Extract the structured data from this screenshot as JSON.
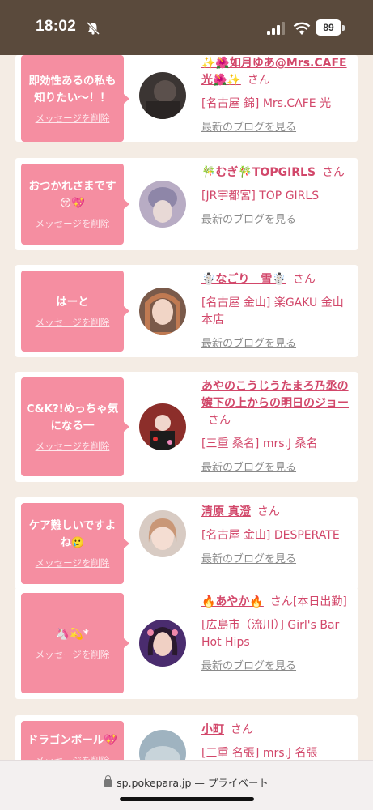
{
  "status_bar": {
    "time": "18:02",
    "battery": "89"
  },
  "messages": [
    {
      "message": "即効性あるの私も知りたい〜！！",
      "delete_label": "メッセージを削除",
      "cast_name": "✨🌺如月ゆあ@Mrs.CAFE光🌺✨",
      "honorific": "さん",
      "shop": "[名古屋 錦] Mrs.CAFE 光",
      "blog_link": "最新のブログを見る",
      "avatar_color": "#3b3533"
    },
    {
      "message": "おつかれさまです😚💖",
      "delete_label": "メッセージを削除",
      "cast_name": "🎋むぎ🎋TOPGIRLS",
      "honorific": "さん",
      "shop": "[JR宇都宮] TOP GIRLS",
      "blog_link": "最新のブログを見る",
      "avatar_color": "#a99cb6"
    },
    {
      "message": "はーと",
      "delete_label": "メッセージを削除",
      "cast_name": "☃️なごり　雪☃️",
      "honorific": "さん",
      "shop": "[名古屋 金山] 楽GAKU 金山本店",
      "blog_link": "最新のブログを見る",
      "avatar_color": "#7a5a4a"
    },
    {
      "message": "C&K?!めっちゃ気になる一",
      "delete_label": "メッセージを削除",
      "cast_name": "あやのこうじうたまろ乃丞の嬢下の上からの明日のジョー",
      "honorific": "さん",
      "shop": "[三重 桑名] mrs.J 桑名",
      "blog_link": "最新のブログを見る",
      "avatar_color": "#8c2e2a"
    },
    {
      "message": "ケア難しいですよね🥲",
      "delete_label": "メッセージを削除",
      "cast_name": "清原 真澄",
      "honorific": "さん",
      "shop": "[名古屋 金山] DESPERATE",
      "blog_link": "最新のブログを見る",
      "avatar_color": "#c9b8b0"
    },
    {
      "message": "🦄💫*",
      "delete_label": "メッセージを削除",
      "cast_name": "🔥あやか🔥",
      "honorific": "さん[本日出勤]",
      "shop": "[広島市（流川）] Girl's Bar Hot Hips",
      "blog_link": "最新のブログを見る",
      "avatar_color": "#4a2c6e"
    },
    {
      "message": "ドラゴンボール💖",
      "delete_label": "メッセージを削除",
      "cast_name": "小町",
      "honorific": "さん",
      "shop": "[三重 名張] mrs.J 名張",
      "blog_link": "",
      "avatar_color": "#9fb3c0"
    }
  ],
  "url_bar": {
    "domain": "sp.pokepara.jp",
    "mode": "— プライベート"
  }
}
